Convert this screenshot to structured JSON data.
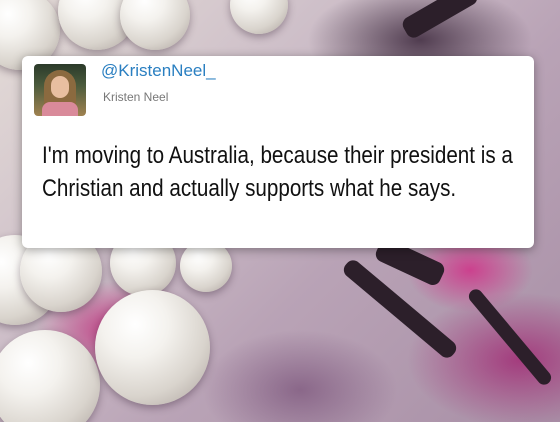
{
  "tweet": {
    "handle": "@KristenNeel_",
    "display_name": "Kristen Neel",
    "text": "I'm moving to Australia, because their president is a Christian and actually supports what he says."
  },
  "colors": {
    "handle": "#2a7fc1",
    "card_background": "#ffffff",
    "text": "#111111"
  }
}
